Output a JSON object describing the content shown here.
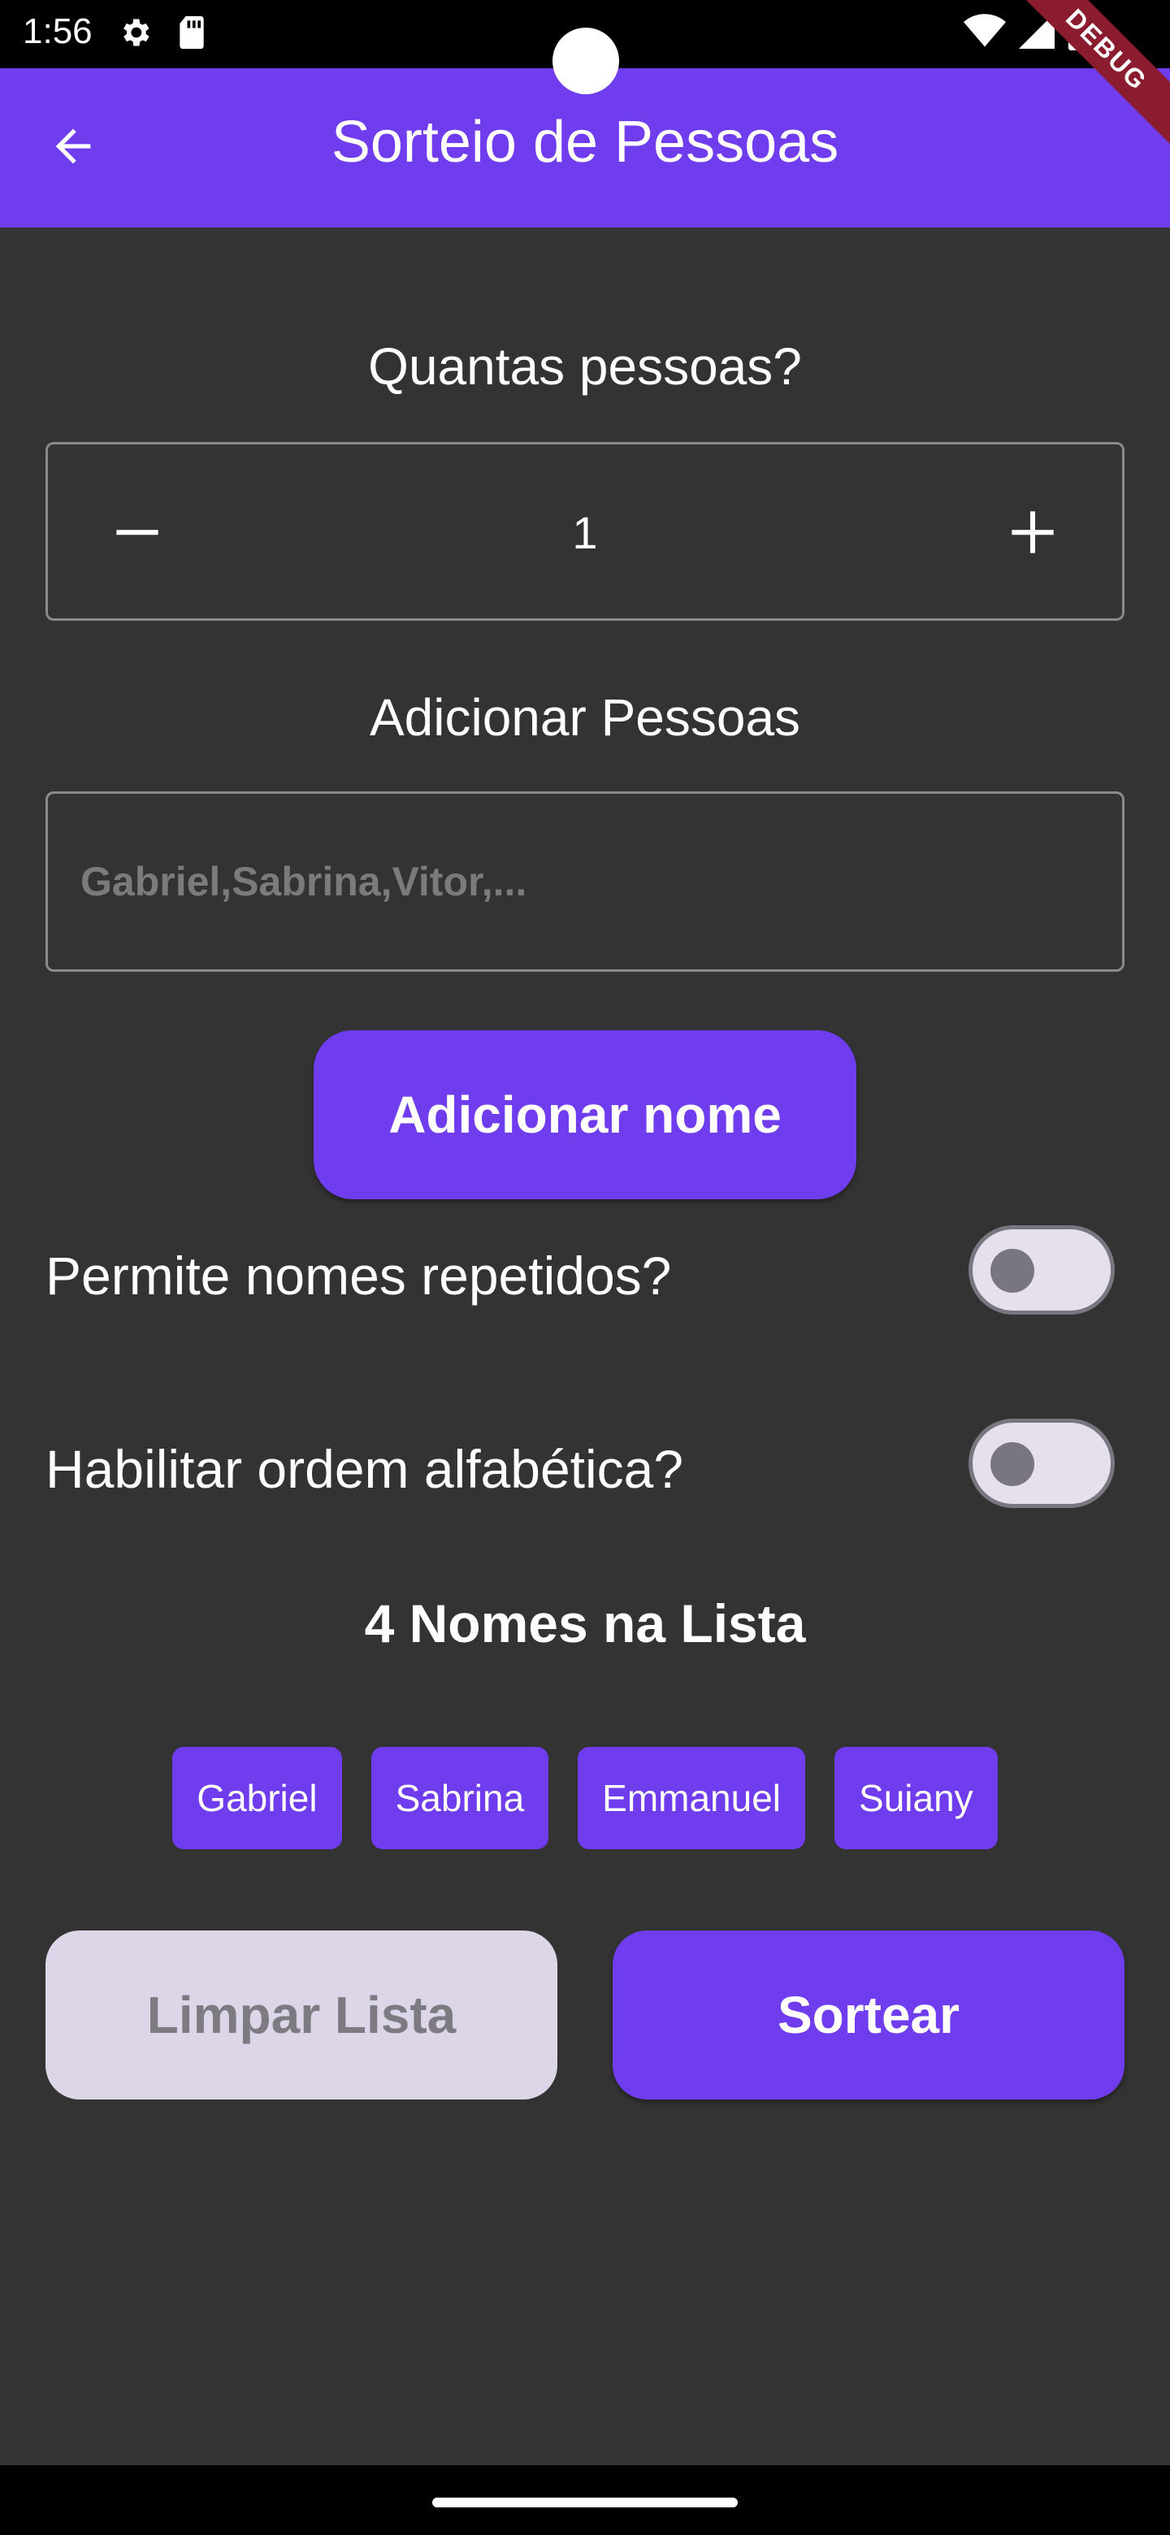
{
  "status_bar": {
    "time": "1:56",
    "icons": [
      "settings-icon",
      "sd-card-icon",
      "wifi-icon",
      "signal-icon",
      "battery-icon"
    ]
  },
  "app_bar": {
    "title": "Sorteio de Pessoas",
    "back_icon": "arrow-back-icon",
    "debug_banner": "DEBUG",
    "color": "#6f3cee"
  },
  "quantity": {
    "heading": "Quantas pessoas?",
    "value": "1",
    "minus_icon": "minus-icon",
    "plus_icon": "plus-icon"
  },
  "add_people": {
    "heading": "Adicionar Pessoas",
    "input_value": "",
    "placeholder": "Gabriel,Sabrina,Vitor,...",
    "button_label": "Adicionar nome"
  },
  "options": {
    "allow_repeated": {
      "label": "Permite nomes repetidos?",
      "enabled": false
    },
    "alphabetical": {
      "label": "Habilitar ordem alfabética?",
      "enabled": false
    }
  },
  "names_list": {
    "count_label": "4 Nomes na Lista",
    "names": [
      "Gabriel",
      "Sabrina",
      "Emmanuel",
      "Suiany"
    ]
  },
  "actions": {
    "clear_label": "Limpar Lista",
    "draw_label": "Sortear"
  },
  "colors": {
    "primary": "#6f3cee",
    "background": "#333333",
    "disabled_button": "#ddd6e8",
    "disabled_text": "#7d7a82",
    "debug_banner": "#8b1c2f"
  }
}
